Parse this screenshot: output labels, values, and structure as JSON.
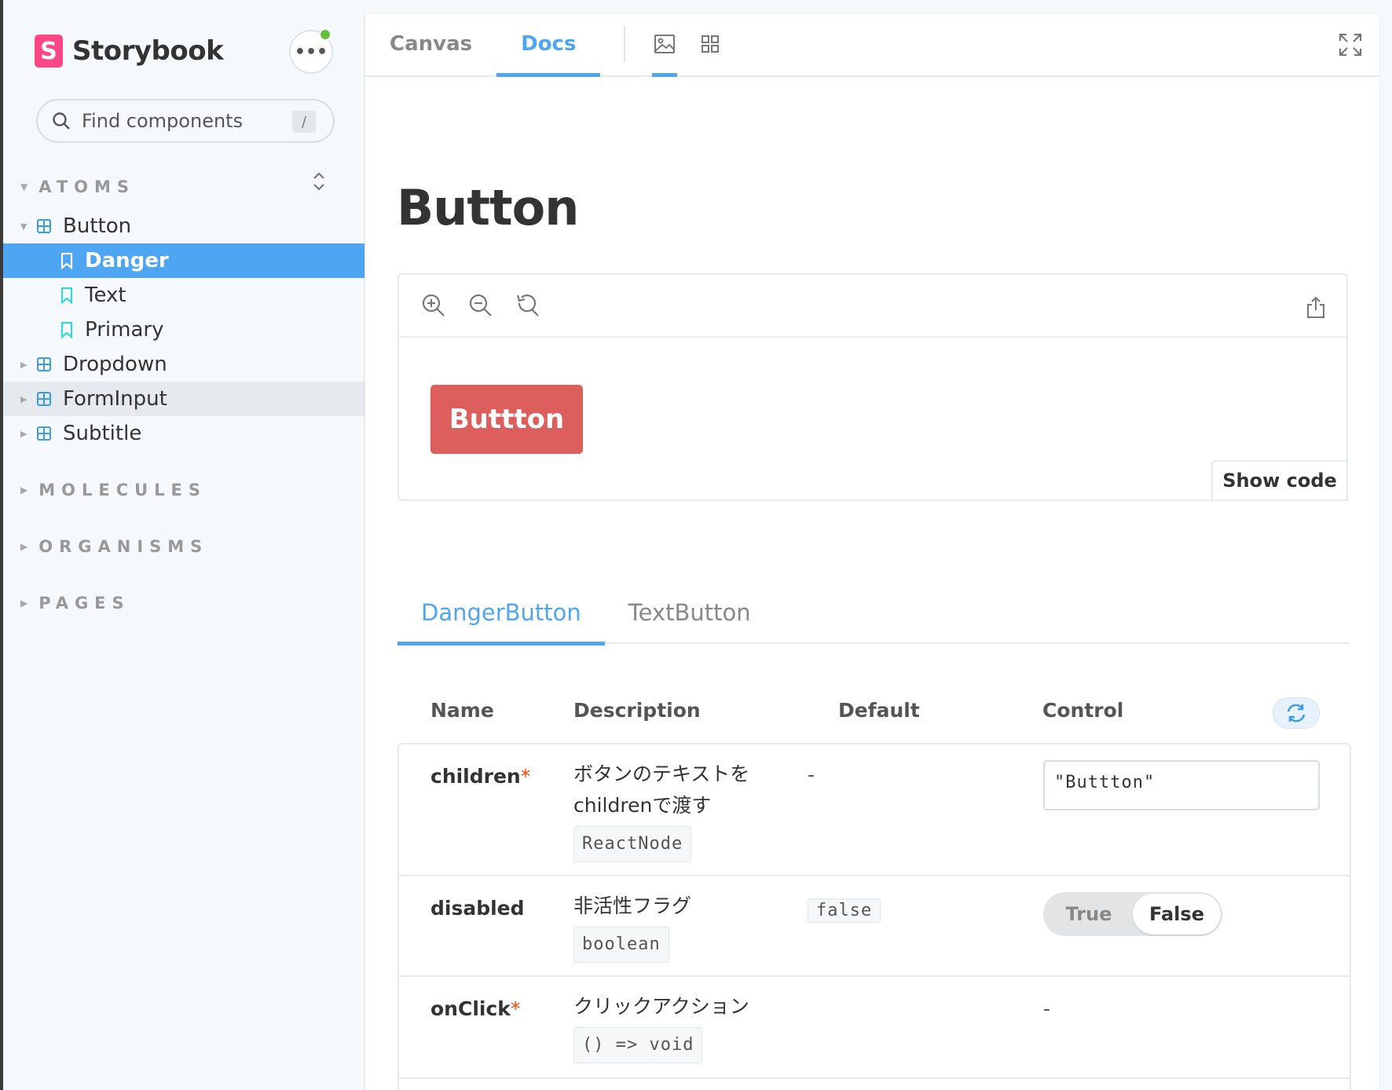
{
  "app": {
    "name": "Storybook"
  },
  "search": {
    "placeholder": "Find components",
    "shortcut": "/"
  },
  "sidebar": {
    "groups": [
      {
        "label": "ATOMS"
      },
      {
        "label": "MOLECULES"
      },
      {
        "label": "ORGANISMS"
      },
      {
        "label": "PAGES"
      }
    ],
    "items": [
      {
        "label": "Button"
      },
      {
        "label": "Danger"
      },
      {
        "label": "Text"
      },
      {
        "label": "Primary"
      },
      {
        "label": "Dropdown"
      },
      {
        "label": "FormInput"
      },
      {
        "label": "Subtitle"
      }
    ]
  },
  "toolbar": {
    "tabs": [
      {
        "label": "Canvas"
      },
      {
        "label": "Docs"
      }
    ]
  },
  "docs": {
    "title": "Button",
    "preview_button_label": "Buttton",
    "show_code_label": "Show code"
  },
  "component_tabs": [
    {
      "label": "DangerButton"
    },
    {
      "label": "TextButton"
    }
  ],
  "args_table": {
    "headers": {
      "name": "Name",
      "description": "Description",
      "default": "Default",
      "control": "Control"
    },
    "rows": [
      {
        "name": "children",
        "required_mark": "*",
        "description_1": "ボタンのテキストを",
        "description_2": "childrenで渡す",
        "type": "ReactNode",
        "default": "-",
        "control_value": "\"Buttton\""
      },
      {
        "name": "disabled",
        "description_1": "非活性フラグ",
        "type": "boolean",
        "default": "false",
        "toggle_true": "True",
        "toggle_false": "False"
      },
      {
        "name": "onClick",
        "required_mark": "*",
        "description_1": "クリックアクション",
        "type": "() => void",
        "control_value": "-"
      }
    ]
  },
  "colors": {
    "accent": "#4ea6f3",
    "brand": "#ff4785",
    "danger_button": "#dc5f5d",
    "status_dot": "#66bf3c"
  }
}
